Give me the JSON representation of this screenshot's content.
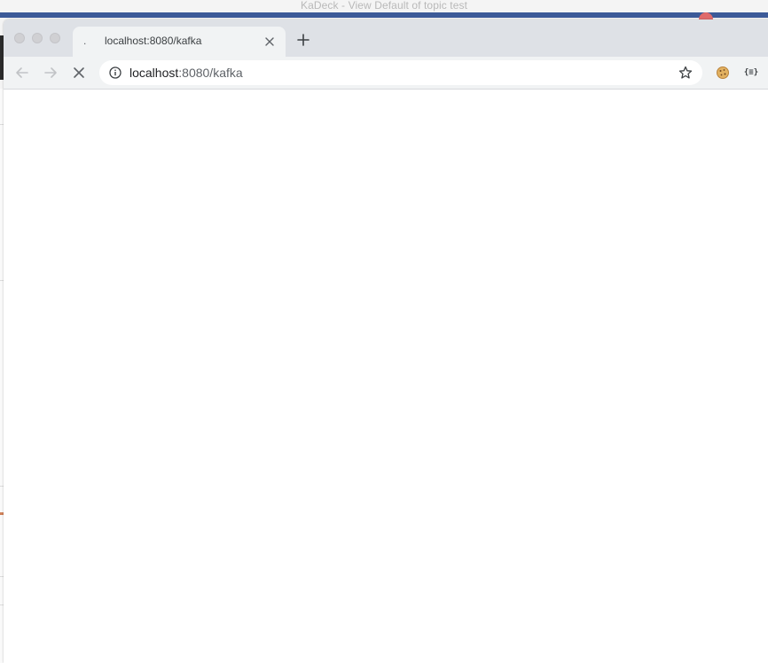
{
  "background_window": {
    "title": "KaDeck - View Default of topic test",
    "accent_color": "#3c5a98"
  },
  "browser": {
    "tab": {
      "favicon": ".",
      "title": "localhost:8080/kafka",
      "close_icon": "close-icon"
    },
    "new_tab_icon": "plus-icon",
    "toolbar": {
      "back_icon": "arrow-left-icon",
      "forward_icon": "arrow-right-icon",
      "stop_icon": "stop-loading-icon"
    },
    "omnibox": {
      "info_icon": "info-icon",
      "url_host": "localhost",
      "url_path": ":8080/kafka",
      "bookmark_icon": "star-icon"
    },
    "extensions": {
      "cookie_icon": "cookie-icon",
      "json_label": "{≡}"
    }
  }
}
